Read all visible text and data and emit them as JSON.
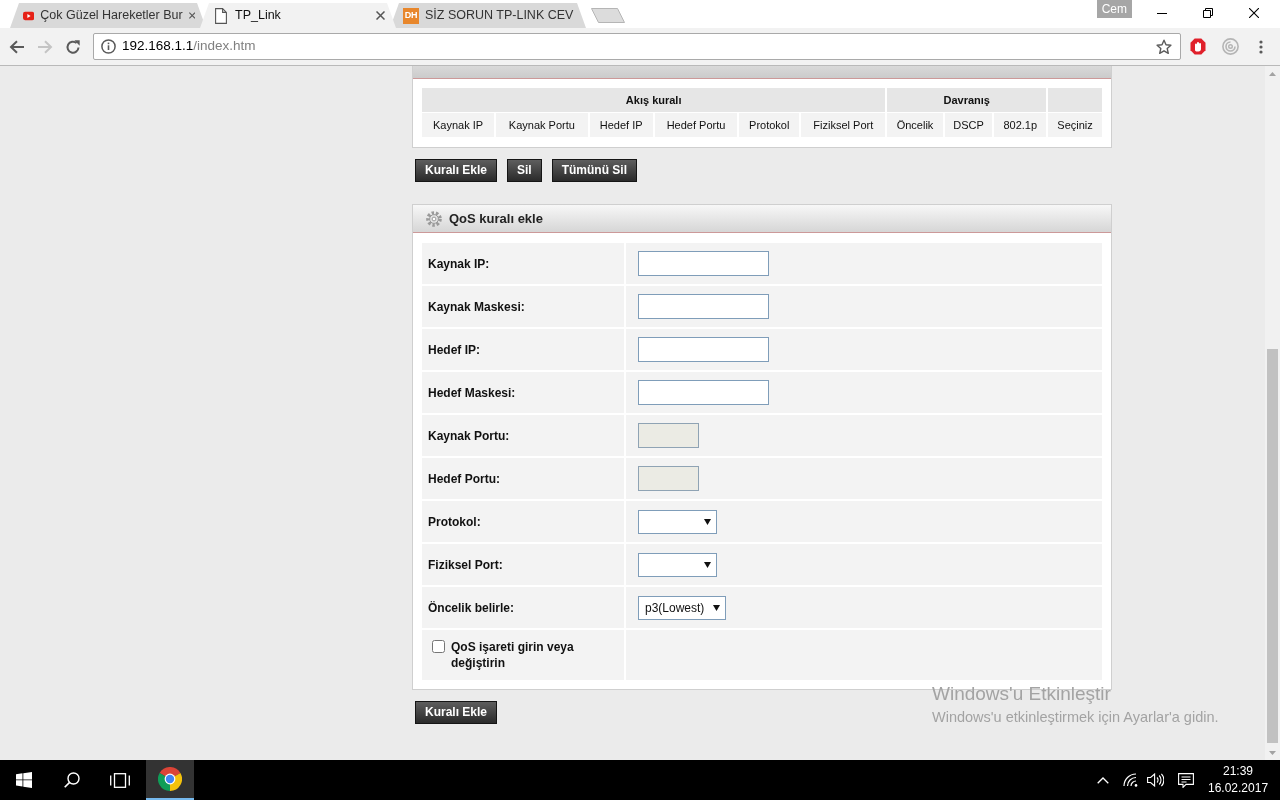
{
  "browser": {
    "tabs": [
      {
        "title": "Çok Güzel Hareketler Bur",
        "kind": "video",
        "selected": false
      },
      {
        "title": "TP_Link",
        "kind": "document",
        "selected": true
      },
      {
        "title": "SİZ SORUN TP-LINK CEV",
        "kind": "letters",
        "logo_text": "DH",
        "selected": false
      }
    ],
    "profile": "Cem",
    "navigation": {
      "back_disabled": false,
      "forward_disabled": true
    },
    "address": {
      "host": "192.168.1.1",
      "path": "/index.htm"
    }
  },
  "rule_list": {
    "column_groups": [
      {
        "label": "Akış kuralı",
        "columns": [
          "Kaynak IP",
          "Kaynak Portu",
          "Hedef IP",
          "Hedef Portu",
          "Protokol",
          "Fiziksel Port"
        ]
      },
      {
        "label": "Davranış",
        "columns": [
          "Öncelik",
          "DSCP",
          "802.1p"
        ]
      },
      {
        "columns": [
          "Seçiniz"
        ]
      }
    ],
    "buttons": [
      "Kuralı Ekle",
      "Sil",
      "Tümünü Sil"
    ]
  },
  "add_rule": {
    "title": "QoS kuralı ekle",
    "fields": [
      {
        "label": "Kaynak IP:",
        "kind": "text",
        "disabled": false
      },
      {
        "label": "Kaynak Maskesi:",
        "kind": "text",
        "disabled": false
      },
      {
        "label": "Hedef IP:",
        "kind": "text",
        "disabled": false
      },
      {
        "label": "Hedef Maskesi:",
        "kind": "text",
        "disabled": false
      },
      {
        "label": "Kaynak Portu:",
        "kind": "text",
        "disabled": true
      },
      {
        "label": "Hedef Portu:",
        "kind": "text",
        "disabled": true
      },
      {
        "label": "Protokol:",
        "kind": "select"
      },
      {
        "label": "Fiziksel Port:",
        "kind": "select"
      },
      {
        "label": "Öncelik belirle:",
        "kind": "select",
        "value": "p3(Lowest)"
      },
      {
        "label": "QoS işareti girin veya değiştirin",
        "kind": "checkbox",
        "checked": false
      }
    ],
    "submit": "Kuralı Ekle"
  },
  "activation_notice": {
    "title": "Windows'u Etkinleştir",
    "message": "Windows'u etkinleştirmek için Ayarlar'a gidin."
  },
  "taskbar": {
    "apps": [
      {
        "kind": "browser",
        "selected": true
      }
    ],
    "clock": {
      "time": "21:39",
      "date": "16.02.2017"
    }
  }
}
